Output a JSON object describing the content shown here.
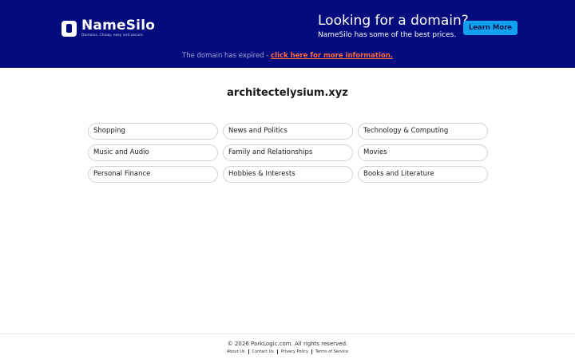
{
  "header": {
    "brand_name": "NameSilo",
    "brand_tagline": "Domains. Cheap, easy and secure",
    "logo_icon": "namesilo-logo-icon",
    "promo_title": "Looking for a domain?",
    "promo_subtitle": "NameSilo has some of the best prices.",
    "learn_more_label": "Learn More",
    "accent_color": "#12a1f0",
    "background_color": "#040b7d"
  },
  "notice": {
    "text": "The domain has expired - ",
    "link_text": "click here for more information.",
    "link_color": "#ff6a3d"
  },
  "main": {
    "domain": "architectelysium.xyz",
    "categories": [
      "Shopping",
      "News and Politics",
      "Technology & Computing",
      "Music and Audio",
      "Family and Relationships",
      "Movies",
      "Personal Finance",
      "Hobbies & Interests",
      "Books and Literature"
    ]
  },
  "footer": {
    "copyright": "© 2026 ParkLogic.com. All rights reserved.",
    "links": [
      "About Us",
      "Contact Us",
      "Privacy Policy",
      "Terms of Service"
    ]
  }
}
